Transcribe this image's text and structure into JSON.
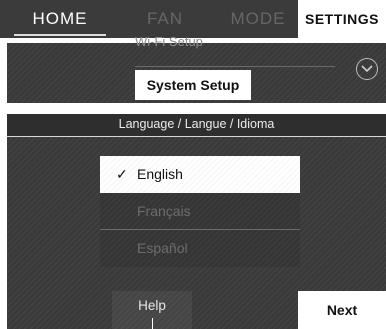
{
  "nav": {
    "home": "HOME",
    "fan": "FAN",
    "mode": "MODE",
    "settings": "SETTINGS"
  },
  "settings_list": {
    "peek_item": "Wi-Fi Setup",
    "selected_item": "System Setup"
  },
  "language": {
    "header": "Language / Langue / Idioma",
    "options": [
      {
        "label": "English",
        "selected": true
      },
      {
        "label": "Français",
        "selected": false
      },
      {
        "label": "Español",
        "selected": false
      }
    ]
  },
  "buttons": {
    "help": "Help",
    "next": "Next"
  },
  "icons": {
    "check": "check-icon",
    "chevron": "chevron-down-icon"
  }
}
